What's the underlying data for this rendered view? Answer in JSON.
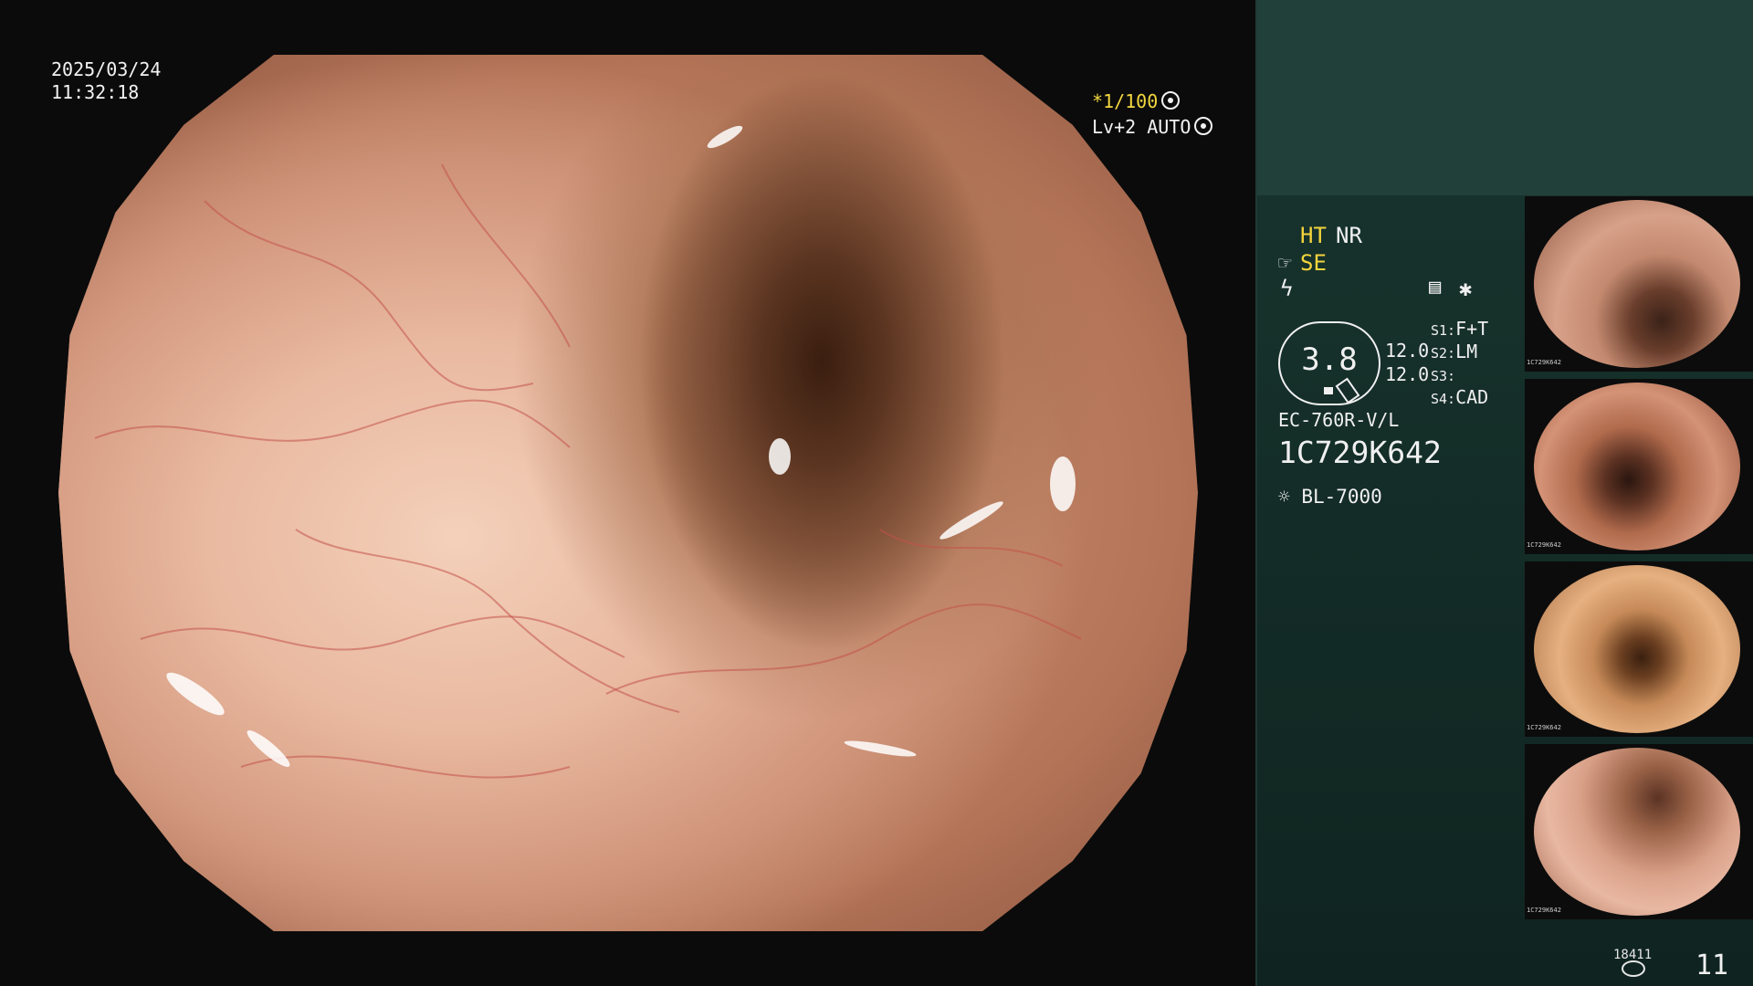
{
  "overlay": {
    "date": "2025/03/24",
    "time": "11:32:18",
    "shutter": "*1/100",
    "level": "Lv+2 AUTO"
  },
  "panel": {
    "mode_ht": "HT",
    "mode_nr": "NR",
    "mode_se": "SE",
    "gauge_value": "3.8",
    "value_1": "12.0",
    "value_2": "12.0",
    "switch_1_label": "S1:",
    "switch_1_value": "F+T",
    "switch_2_label": "S2:",
    "switch_2_value": "LM",
    "switch_3_label": "S3:",
    "switch_3_value": "",
    "switch_4_label": "S4:",
    "switch_4_value": "CAD",
    "scope_model": "EC-760R-V/L",
    "scope_serial": "1C729K642",
    "light_source": "BL-7000",
    "storage_count": "18411",
    "image_count": "11"
  },
  "thumbnails": [
    {
      "serial": "1C729K642"
    },
    {
      "serial": "1C729K642"
    },
    {
      "serial": "1C729K642"
    },
    {
      "serial": "1C729K642"
    }
  ],
  "icons": {
    "video_settings": "film-reel-icon",
    "mode_hand": "hand-icon",
    "flash": "lightning-icon",
    "memory": "memory-card-icon",
    "asterisk": "asterisk-icon",
    "light": "sun-icon",
    "storage": "disk-icon"
  }
}
